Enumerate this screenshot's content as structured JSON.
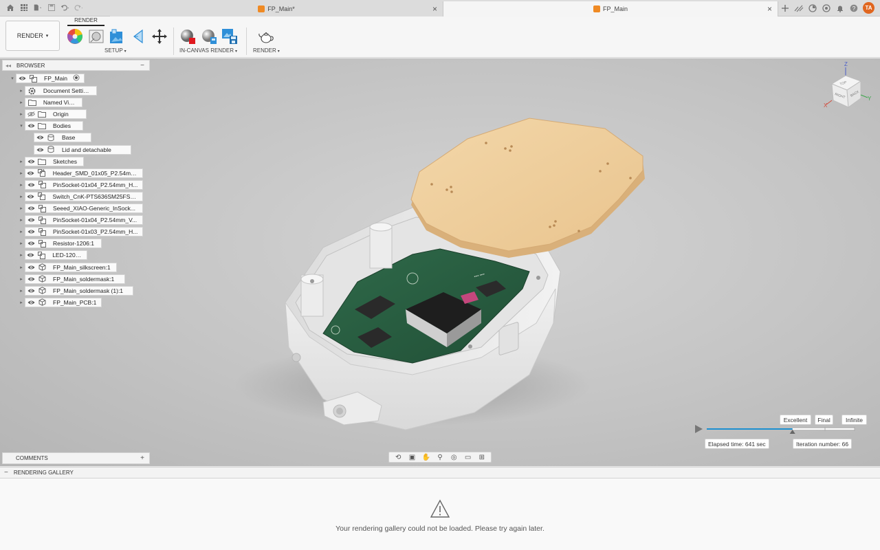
{
  "tabs": [
    {
      "label": "FP_Main*",
      "active": false
    },
    {
      "label": "FP_Main",
      "active": true
    }
  ],
  "user_initials": "TA",
  "toolbar": {
    "workspace": "RENDER",
    "active_tab": "RENDER",
    "groups": {
      "setup": "SETUP",
      "in_canvas_render": "IN-CANVAS RENDER",
      "render": "RENDER"
    }
  },
  "browser": {
    "title": "BROWSER",
    "root": "FP_Main",
    "items": [
      {
        "label": "Document Settings",
        "icon": "gear-icon"
      },
      {
        "label": "Named Views",
        "icon": "folder-icon"
      },
      {
        "label": "Origin",
        "icon": "folder-icon",
        "hidden": true
      },
      {
        "label": "Bodies",
        "icon": "folder-icon",
        "expanded": true
      },
      {
        "label": "Base",
        "icon": "body-icon"
      },
      {
        "label": "Lid and detachable",
        "icon": "body-icon"
      },
      {
        "label": "Sketches",
        "icon": "folder-icon"
      },
      {
        "label": "Header_SMD_01x05_P2.54mm...",
        "icon": "component-link-icon"
      },
      {
        "label": "PinSocket-01x04_P2.54mm_H...",
        "icon": "component-icon"
      },
      {
        "label": "Switch_CnK-PTS636SM25FSM...",
        "icon": "component-icon"
      },
      {
        "label": "Seeed_XIAO-Generic_InSock...",
        "icon": "component-icon"
      },
      {
        "label": "PinSocket-01x04_P2.54mm_V...",
        "icon": "component-icon"
      },
      {
        "label": "PinSocket-01x03_P2.54mm_H...",
        "icon": "component-icon"
      },
      {
        "label": "Resistor-1206:1",
        "icon": "component-icon"
      },
      {
        "label": "LED-1206:1",
        "icon": "component-icon"
      },
      {
        "label": "FP_Main_silkscreen:1",
        "icon": "mesh-icon"
      },
      {
        "label": "FP_Main_soldermask:1",
        "icon": "mesh-icon"
      },
      {
        "label": "FP_Main_soldermask (1):1",
        "icon": "mesh-icon"
      },
      {
        "label": "FP_Main_PCB:1",
        "icon": "mesh-icon"
      }
    ]
  },
  "comments": {
    "title": "COMMENTS"
  },
  "viewcube": {
    "top": "TOP",
    "right": "RIGHT",
    "back": "BACK",
    "axis_x": "X",
    "axis_y": "Y",
    "axis_z": "Z"
  },
  "render_progress": {
    "quality_levels": [
      "Excellent",
      "Final",
      "Infinite"
    ],
    "progress_fraction": 0.58,
    "elapsed": "Elapsed time: 641 sec",
    "iteration": "Iteration number: 66"
  },
  "gallery": {
    "title": "RENDERING GALLERY",
    "message": "Your rendering gallery could not be loaded. Please try again later."
  }
}
